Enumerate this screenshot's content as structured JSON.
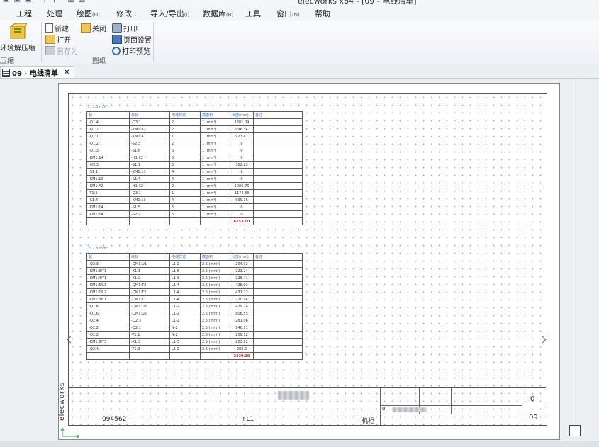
{
  "window": {
    "title_fragment": "elecworks x64 - [09 - 电线清单]"
  },
  "menu": [
    {
      "label": "工程"
    },
    {
      "label": "处理"
    },
    {
      "label": "绘图",
      "key": "(D)"
    },
    {
      "label": "修改..."
    },
    {
      "label": "导入/导出",
      "key": "(I)"
    },
    {
      "label": "数据库",
      "key": "(B)"
    },
    {
      "label": "工具"
    },
    {
      "label": "窗口",
      "key": "(N)"
    },
    {
      "label": "帮助"
    }
  ],
  "ribbon": {
    "compress_label": "环境解压缩",
    "group1_label": "压缩",
    "new_label": "新建",
    "close_label": "关闭",
    "open_label": "打开",
    "saveas_label": "另存为",
    "print_label": "打印",
    "pagesetup_label": "页面设置",
    "preview_label": "打印预览",
    "group2_label": "图纸"
  },
  "doctab": {
    "label": "09 - 电线清单"
  },
  "table1": {
    "caption": "1: 1.5 mm²",
    "headers": [
      "起",
      "目标",
      "电线样式",
      "截面积",
      "长度(mm)",
      "备注"
    ],
    "rows": [
      [
        "-Q1:4",
        "-Q3:1",
        "2",
        "1 (mm²)",
        "1201.09",
        ""
      ],
      [
        "-Q1:2",
        "-KM1:A2",
        "2",
        "1 (mm²)",
        "996.34",
        ""
      ],
      [
        "-Q1:1",
        "-KM1:A1",
        "1",
        "1 (mm²)",
        "923.41",
        ""
      ],
      [
        "-Q1:2",
        "-S2:3",
        "2",
        "1 (mm²)",
        "0",
        ""
      ],
      [
        "-Q1:3",
        "-S1:6",
        "6",
        "1 (mm²)",
        "0",
        ""
      ],
      [
        "-KM1:14",
        "-H1:X2",
        "6",
        "1 (mm²)",
        "0",
        ""
      ],
      [
        "-Q3:3",
        "-S1:1",
        "3",
        "1 (mm²)",
        "382.23",
        ""
      ],
      [
        "-S1:1",
        "-KM1:13",
        "4",
        "1 (mm²)",
        "0",
        ""
      ],
      [
        "-KM1:13",
        "-S1:4",
        "4",
        "1 (mm²)",
        "0",
        ""
      ],
      [
        "-KM1:A2",
        "-H1:X2",
        "2",
        "1 (mm²)",
        "1086.76",
        ""
      ],
      [
        "-T1:3",
        "-Q3:1",
        "1",
        "1 (mm²)",
        "1174.88",
        ""
      ],
      [
        "-S1:4",
        "-KM1:13",
        "4",
        "1 (mm²)",
        "999.16",
        ""
      ],
      [
        "-KM1:14",
        "-S1:5",
        "5",
        "1 (mm²)",
        "0",
        ""
      ],
      [
        "-KM1:14",
        "-S2:2",
        "5",
        "1 (mm²)",
        "0",
        ""
      ]
    ],
    "total": "6753.00"
  },
  "table2": {
    "caption": "2: 2.5 mm²",
    "headers": [
      "起",
      "目标",
      "电线样式",
      "截面积",
      "长度(mm)",
      "备注"
    ],
    "rows": [
      [
        "-Q2:3",
        "-QM1:U1",
        "L1-2",
        "2.5 (mm²)",
        "204.02",
        ""
      ],
      [
        "-KM1:3/T1",
        "-X1:1",
        "L1-5",
        "2.5 (mm²)",
        "223.24",
        ""
      ],
      [
        "-KM1:4/T1",
        "-X1:2",
        "L1-3",
        "2.5 (mm²)",
        "226.41",
        ""
      ],
      [
        "-KM1:5/L3",
        "-QM1:T3",
        "L1-4",
        "2.5 (mm²)",
        "428.02",
        ""
      ],
      [
        "-KM1:1/L2",
        "-QM1:T2",
        "L1-4",
        "2.5 (mm²)",
        "431.22",
        ""
      ],
      [
        "-KM1:3/L1",
        "-QM1:T1",
        "L1-4",
        "2.5 (mm²)",
        "220.94",
        ""
      ],
      [
        "-Q1:6",
        "-QM1:U3",
        "L1-2",
        "2.5 (mm²)",
        "429.24",
        ""
      ],
      [
        "-Q1:6",
        "-QM1:U2",
        "L1-2",
        "2.5 (mm²)",
        "806.55",
        ""
      ],
      [
        "-Q2:4",
        "-Q2:3",
        "L1-2",
        "2.5 (mm²)",
        "281.06",
        ""
      ],
      [
        "-Q2:2",
        "-Q2:1",
        "N-2",
        "2.5 (mm²)",
        "146.11",
        ""
      ],
      [
        "-Q2:2",
        "-T1:1",
        "N-2",
        "2.5 (mm²)",
        "209.12",
        ""
      ],
      [
        "-KM1:6/T3",
        "-X1:3",
        "L1-3",
        "2.5 (mm²)",
        "203.92",
        ""
      ],
      [
        "-Q2:4",
        "-T1:2",
        "L1-2",
        "2.5 (mm²)",
        "282.2",
        ""
      ]
    ],
    "total": "3339.38"
  },
  "titleblock": {
    "brand": "elecworks",
    "drawing_number": "094562",
    "location": "+L1",
    "cabinet": "机柜",
    "rev": "0",
    "sheet_rev": "0",
    "sheet_no": "09"
  }
}
